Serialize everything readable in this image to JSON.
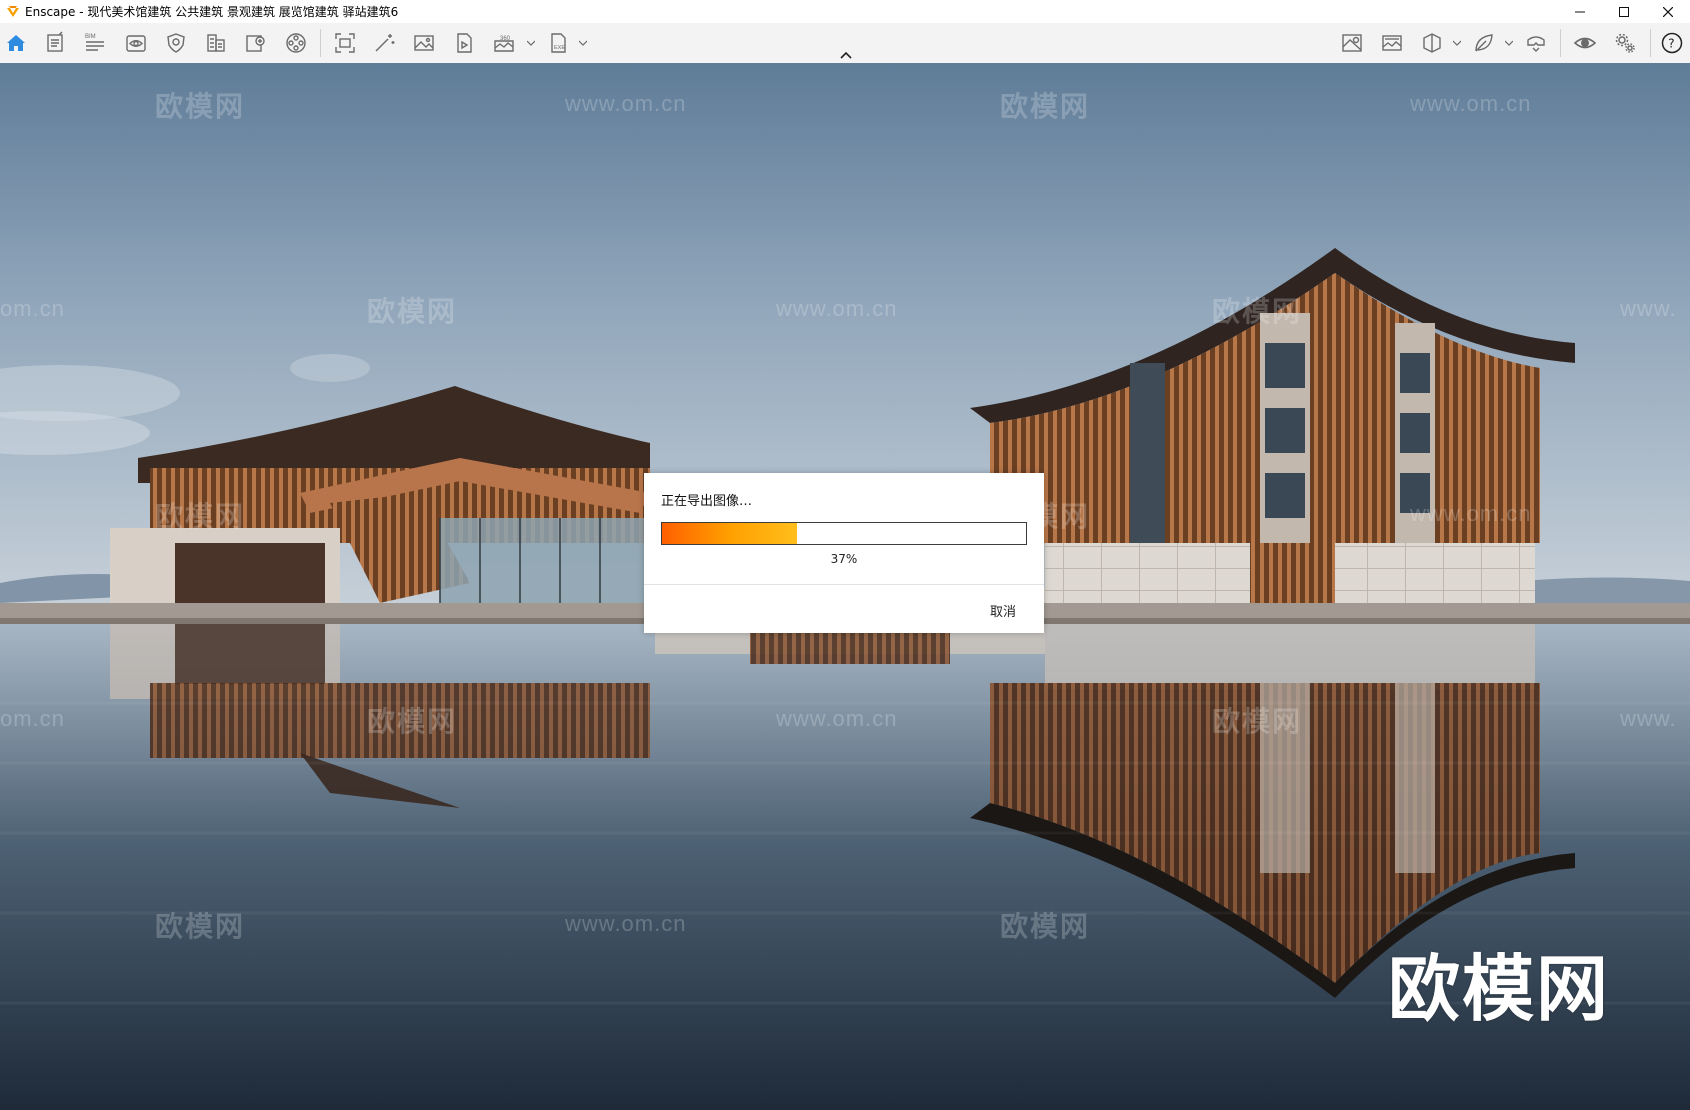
{
  "window": {
    "title": "Enscape - 现代美术馆建筑 公共建筑 景观建筑 展览馆建筑 驿站建筑6",
    "accent": "#f5a000"
  },
  "toolbar": {
    "left_icons": [
      "home-icon",
      "document-icon",
      "bim-list-icon",
      "eye-panel-icon",
      "sun-shield-icon",
      "building-icon",
      "asset-library-icon",
      "material-palette-icon",
      "screenshot-icon",
      "magic-wand-icon",
      "image-icon",
      "video-file-icon",
      "panorama-360-icon",
      "exe-export-icon"
    ],
    "right_icons": [
      "map-icon",
      "image-gallery-icon",
      "cube-view-icon",
      "leaf-icon",
      "vr-headset-icon",
      "visibility-eye-icon",
      "settings-gears-icon",
      "help-icon"
    ],
    "active_color": "#2f8be0"
  },
  "watermarks": {
    "brand_cn": "欧模网",
    "domain": "www.om.cn",
    "domain_partial_left": "om.cn",
    "domain_partial_right": "www.",
    "corner_logo": "欧模网"
  },
  "dialog": {
    "message": "正在导出图像…",
    "progress": 0.37,
    "progress_label": "37%",
    "cancel_label": "取消"
  }
}
